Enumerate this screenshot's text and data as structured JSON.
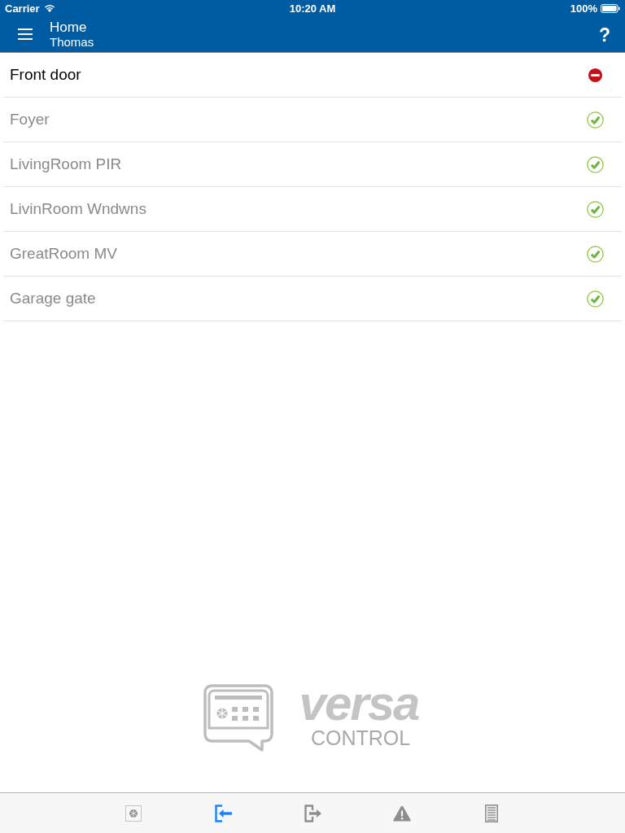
{
  "status_bar": {
    "carrier": "Carrier",
    "time": "10:20 AM",
    "battery": "100%"
  },
  "nav_bar": {
    "title": "Home",
    "subtitle": "Thomas",
    "help": "?"
  },
  "zones": [
    {
      "name": "Front door",
      "violated": true
    },
    {
      "name": "Foyer",
      "violated": false
    },
    {
      "name": "LivingRoom PIR",
      "violated": false
    },
    {
      "name": "LivinRoom Wndwns",
      "violated": false
    },
    {
      "name": "GreatRoom MV",
      "violated": false
    },
    {
      "name": "Garage gate",
      "violated": false
    }
  ],
  "logo": {
    "name": "versa",
    "tagline": "CONTROL"
  },
  "tabs": [
    {
      "kind": "keypad",
      "selected": false
    },
    {
      "kind": "enter",
      "selected": true
    },
    {
      "kind": "exit",
      "selected": false
    },
    {
      "kind": "alert",
      "selected": false
    },
    {
      "kind": "list",
      "selected": false
    }
  ]
}
